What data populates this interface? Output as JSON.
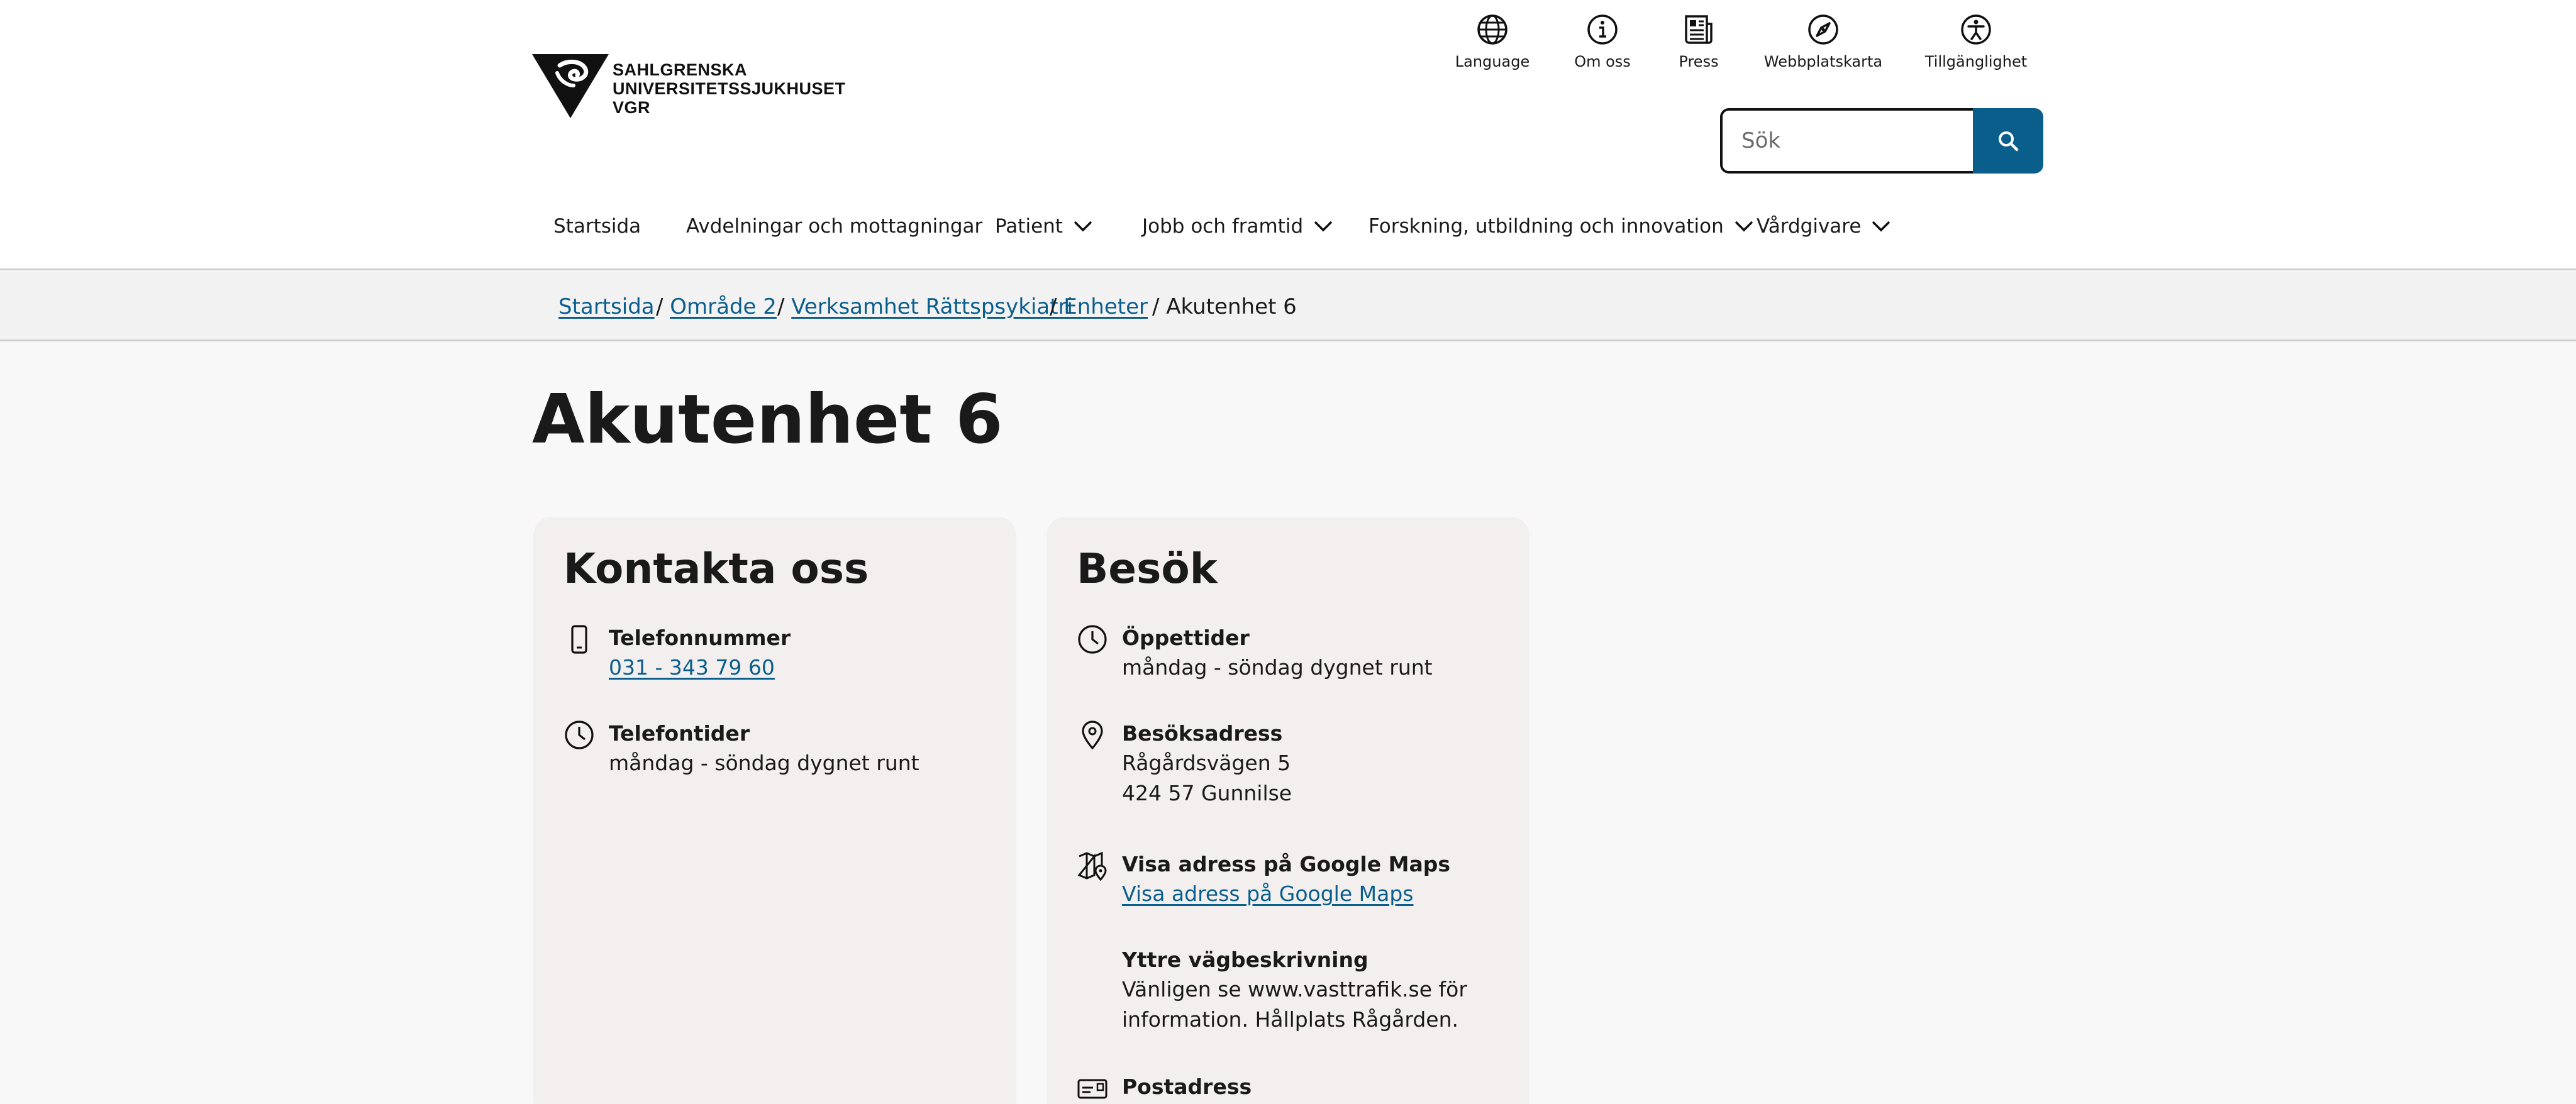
{
  "logo": {
    "line1": "SAHLGRENSKA",
    "line2": "UNIVERSITETSSJUKHUSET",
    "line3": "VGR"
  },
  "utility": [
    {
      "label": "Language",
      "icon": "globe-icon"
    },
    {
      "label": "Om oss",
      "icon": "info-icon"
    },
    {
      "label": "Press",
      "icon": "newspaper-icon"
    },
    {
      "label": "Webbplatskarta",
      "icon": "compass-icon"
    },
    {
      "label": "Tillgänglighet",
      "icon": "accessibility-icon"
    }
  ],
  "search": {
    "placeholder": "Sök",
    "button_icon": "search-icon"
  },
  "nav": [
    {
      "label": "Startsida",
      "has_dropdown": false
    },
    {
      "label": "Avdelningar och mottagningar",
      "has_dropdown": false
    },
    {
      "label": "Patient",
      "has_dropdown": true
    },
    {
      "label": "Jobb och framtid",
      "has_dropdown": true
    },
    {
      "label": "Forskning, utbildning och innovation",
      "has_dropdown": true
    },
    {
      "label": "Vårdgivare",
      "has_dropdown": true
    }
  ],
  "breadcrumb": [
    {
      "label": "Startsida",
      "link": true
    },
    {
      "label": "Område 2",
      "link": true
    },
    {
      "label": "Verksamhet Rättspsykiatri",
      "link": true
    },
    {
      "label": "Enheter",
      "link": true
    },
    {
      "label": "Akutenhet 6",
      "link": false
    }
  ],
  "page_title": "Akutenhet 6",
  "contact": {
    "title": "Kontakta oss",
    "phone_label": "Telefonnummer",
    "phone_value": "031 - 343 79 60",
    "hours_label": "Telefontider",
    "hours_value": "måndag - söndag dygnet runt"
  },
  "visit": {
    "title": "Besök",
    "open_label": "Öppettider",
    "open_value": "måndag - söndag dygnet runt",
    "address_label": "Besöksadress",
    "address_line1": "Rågårdsvägen 5",
    "address_line2": "424 57 Gunnilse",
    "maps_label": "Visa adress på Google Maps",
    "maps_link": "Visa adress på Google Maps",
    "directions_label": "Yttre vägbeskrivning",
    "directions_line1": "Vänligen se www.vasttrafik.se för",
    "directions_line2": "information. Hållplats Rågården.",
    "postal_label": "Postadress"
  },
  "colors": {
    "link": "#0a5e8c",
    "search_button": "#0a5e8c",
    "card_bg": "#f2efee",
    "page_bg": "#f8f8f8"
  }
}
